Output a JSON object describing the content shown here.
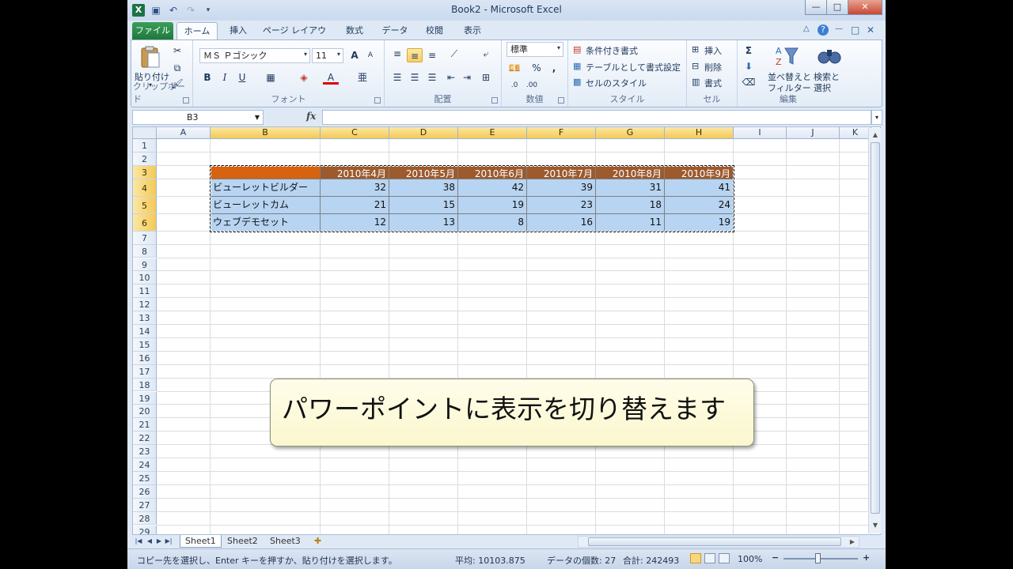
{
  "window": {
    "title": "Book2 - Microsoft Excel",
    "app_icon": "X",
    "controls": [
      "—",
      "□",
      "✕"
    ],
    "help_controls": [
      "△",
      "?",
      "—",
      "□",
      "✕"
    ]
  },
  "ribbon_tabs": [
    {
      "label": "ファイル",
      "icon": "file-tab"
    },
    {
      "label": "ホーム"
    },
    {
      "label": "挿入"
    },
    {
      "label": "ページ レイアウト"
    },
    {
      "label": "数式"
    },
    {
      "label": "データ"
    },
    {
      "label": "校閲"
    },
    {
      "label": "表示"
    }
  ],
  "groups": {
    "clipboard": {
      "label": "クリップボード",
      "paste": "貼り付け"
    },
    "font": {
      "label": "フォント",
      "font_name": "ＭＳ Ｐゴシック",
      "font_size": "11",
      "bold": "B",
      "italic": "I",
      "underline": "U",
      "grow": "A",
      "shrink": "A",
      "font_color": "A"
    },
    "alignment": {
      "label": "配置"
    },
    "number": {
      "label": "数値",
      "format": "標準",
      "percent": "%",
      "comma": ","
    },
    "styles": {
      "label": "スタイル",
      "conditional": "条件付き書式",
      "as_table": "テーブルとして書式設定",
      "cell_styles": "セルのスタイル"
    },
    "cells": {
      "label": "セル",
      "insert": "挿入",
      "delete": "削除",
      "format": "書式"
    },
    "editing": {
      "label": "編集",
      "sigma": "Σ",
      "sort_filter_1": "並べ替えと",
      "sort_filter_2": "フィルター",
      "find_1": "検索と",
      "find_2": "選択"
    }
  },
  "formula_bar": {
    "name_box": "B3",
    "fx": "fx",
    "formula": ""
  },
  "columns": [
    "A",
    "B",
    "C",
    "D",
    "E",
    "F",
    "G",
    "H",
    "I",
    "J",
    "K"
  ],
  "selected_columns": [
    "B",
    "C",
    "D",
    "E",
    "F",
    "G",
    "H"
  ],
  "rows": [
    "1",
    "2",
    "3",
    "4",
    "5",
    "6",
    "7",
    "8",
    "9",
    "10",
    "11",
    "12",
    "13",
    "14",
    "15",
    "16",
    "17",
    "18",
    "19",
    "20",
    "21",
    "22",
    "23",
    "24",
    "25",
    "26",
    "27",
    "28",
    "29"
  ],
  "selected_rows": [
    "3",
    "4",
    "5",
    "6"
  ],
  "table": {
    "header": [
      "",
      "2010年4月",
      "2010年5月",
      "2010年6月",
      "2010年7月",
      "2010年8月",
      "2010年9月"
    ],
    "rows": [
      {
        "name": "ビューレットビルダー",
        "values": [
          "32",
          "38",
          "42",
          "39",
          "31",
          "41"
        ]
      },
      {
        "name": "ビューレットカム",
        "values": [
          "21",
          "15",
          "19",
          "23",
          "18",
          "24"
        ]
      },
      {
        "name": "ウェブデモセット",
        "values": [
          "12",
          "13",
          "8",
          "16",
          "11",
          "19"
        ]
      }
    ]
  },
  "callout": {
    "text": "パワーポイントに表示を切り替えます"
  },
  "sheets": [
    {
      "name": "Sheet1",
      "active": true
    },
    {
      "name": "Sheet2",
      "active": false
    },
    {
      "name": "Sheet3",
      "active": false
    }
  ],
  "status": {
    "message": "コピー先を選択し、Enter キーを押すか、貼り付けを選択します。",
    "average": "平均: 10103.875",
    "count": "データの個数: 27",
    "sum": "合計: 242493",
    "zoom": "100%",
    "zoom_minus": "−",
    "zoom_plus": "+"
  },
  "colors": {
    "header_fill": "#9c5a2d",
    "header_first": "#d7620f",
    "data_fill": "#b7d4f2",
    "accent_green": "#1f7a3c"
  }
}
